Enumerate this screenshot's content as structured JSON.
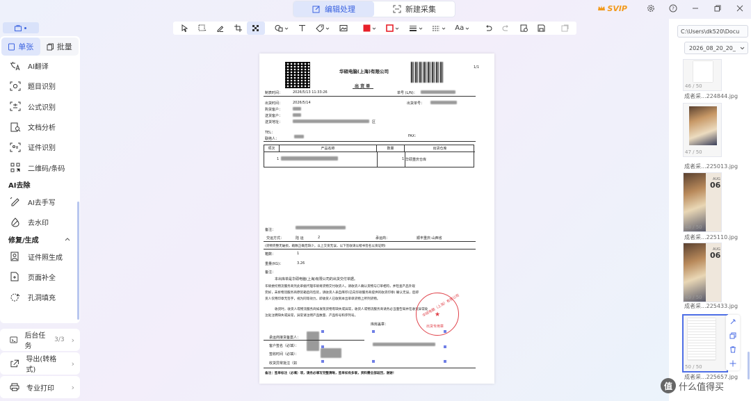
{
  "title_bar": {
    "tabs": [
      {
        "label": "编辑处理",
        "active": true
      },
      {
        "label": "新建采集",
        "active": false
      }
    ],
    "svip_label": "SVIP"
  },
  "left_panel": {
    "segments": [
      {
        "label": "单张",
        "active": true
      },
      {
        "label": "批量",
        "active": false
      }
    ],
    "items_top": [
      "AI翻译",
      "题目识别",
      "公式识别",
      "文档分析",
      "证件识别",
      "二维码/条码"
    ],
    "section_ai_remove": {
      "title": "AI去除",
      "items": [
        "AI去手写",
        "去水印"
      ]
    },
    "section_repair": {
      "title": "修复/生成",
      "items": [
        "证件照生成",
        "页面补全",
        "孔洞填充"
      ]
    },
    "bottom": {
      "tasks_label": "后台任务",
      "tasks_count": "3/3",
      "export_label": "导出(转格式)",
      "print_label": "专业打印"
    }
  },
  "toolbar": {
    "tools": [
      "pointer",
      "rect-select",
      "pen",
      "crop",
      "mosaic",
      "shape",
      "text",
      "tag",
      "image",
      "color-fill",
      "color-stroke",
      "line-style",
      "dash-style",
      "font",
      "undo",
      "redo",
      "history",
      "save",
      "clear"
    ],
    "fill_color": "#e8202a",
    "stroke_color": "#e8202a",
    "font_label": "Aa"
  },
  "document": {
    "company": "华硕电脑(上海)有限公司",
    "page_no": "1/1",
    "doc_title": "出 货 单",
    "make_time_label": "制表时间：",
    "make_time": "2026/5/13 11:33:26",
    "order_no_label": "单号 (L/N)：",
    "ship_time_label": "出货时间：",
    "ship_time": "2026/5/14",
    "ship_no_label": "出货单号：",
    "buy_customer_label": "购货客户：",
    "deliver_customer_label": "送货客户：",
    "deliver_addr_label": "送货地址：",
    "district": "区",
    "tel_label": "TEL：",
    "fax_label": "FAX：",
    "contact_label": "联络人：",
    "table_headers": [
      "项次",
      "产品名称",
      "数量",
      "出货仓库"
    ],
    "row_index": "1",
    "row_qty": "1",
    "row_warehouse": "华硕重庆仓库",
    "remark_label": "备注：",
    "transport_label": "交运方式：",
    "transport_value": "陆 运",
    "transport_num": "2",
    "carrier_label": "承运商：",
    "carrier_value": "顺丰重庆-山西省",
    "notice": "(货物完整无破损，箱数正确无缺少，以上交货无误，以下签收请以楷书签名以资证明)",
    "box_label": "箱数：",
    "box_value": "1",
    "weight_label": "重量(KG)：",
    "weight_value": "3.26",
    "remark2_label": "备注：",
    "para1": "本出库单是华硕电脑(上海)有限公司的出货交付单据。",
    "para2a": "华硕委托物流服务商凭此单据代理华硕将货物交付收货人。请收货人确认货物与订单相符，并检查产品外观",
    "para2b": "完好，未拆物流服务商原装箱后的包装，请收货人表自库印(已向华硕服务商提供的收货印章) 确认无误，后即",
    "para2c": "货人仅用印章无签字，视为同等效力，即收货人已收到本出单单货物上所列货物。",
    "para3a": "收货时，收货人或物流服务商如发现货物有缺失或异常，收货人或物流服务商请务必当面告知并在收货异常处",
    "para3b": "注处注明缺失或异常，异常请注明产品数量、产品料号和序列号。",
    "stamp_label": "库房盖章：",
    "stamp_text_top": "华硕电脑（上海）有限公司",
    "stamp_text_bottom": "出货专用章",
    "carrier_sign_label": "承运商接货备案人：",
    "cust_name_label": "客户签名（必填）：",
    "sign_time_label": "签收时间（必填）：",
    "abnormal_label": "收货异常批注（如",
    "footer": "备注：签单标注（必填）项，请务必填写完整清晰，签单如有多联，资料需全部返回，谢谢！"
  },
  "right_panel": {
    "path": "C:\\Users\\dk520\\Docu",
    "folder": "2026_08_20_20_",
    "thumbs": [
      {
        "idx": "46 / 50",
        "name": "成者采...224844.jpg"
      },
      {
        "idx": "47 / 50",
        "name": "成者采...225013.jpg"
      },
      {
        "idx": "48 / 50",
        "name": "成者采...225110.jpg"
      },
      {
        "idx": "49 / 50",
        "name": "成者采...225433.jpg"
      },
      {
        "idx": "50 / 50",
        "name": "成者采...225657.jpg"
      }
    ],
    "art_month": "AUG",
    "art_day": "06"
  },
  "watermark": {
    "symbol": "值",
    "text": "什么值得买"
  }
}
